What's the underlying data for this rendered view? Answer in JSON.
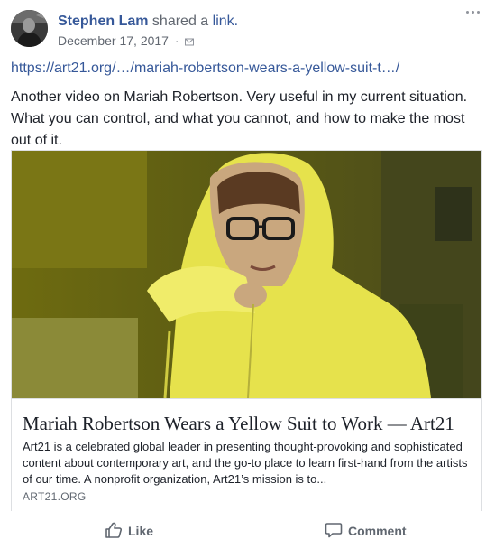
{
  "post": {
    "author": "Stephen Lam",
    "action_text": "shared a",
    "action_link": "link.",
    "date": "December 17, 2017",
    "separator": "·",
    "url": "https://art21.org/…/mariah-robertson-wears-a-yellow-suit-t…/",
    "text": "Another video on Mariah Robertson. Very useful in my current situation. What you can control, and what you cannot, and how to make the most out of it."
  },
  "card": {
    "title": "Mariah Robertson Wears a Yellow Suit to Work — Art21",
    "description": "Art21 is a celebrated global leader in presenting thought-provoking and sophisticated content about contemporary art, and the go-to place to learn first-hand from the artists of our time. A nonprofit organization, Art21’s mission is to...",
    "domain": "ART21.ORG"
  },
  "actions": {
    "like_label": "Like",
    "comment_label": "Comment"
  },
  "icons": {
    "avatar": "profile-photo",
    "audience": "envelope-icon",
    "more": "more-options-icon",
    "like": "thumbs-up-icon",
    "comment": "speech-bubble-icon"
  },
  "colors": {
    "link": "#365899",
    "text": "#1d2129",
    "meta": "#616770",
    "border": "#dddfe2",
    "suit_yellow": "#e8e24a"
  }
}
